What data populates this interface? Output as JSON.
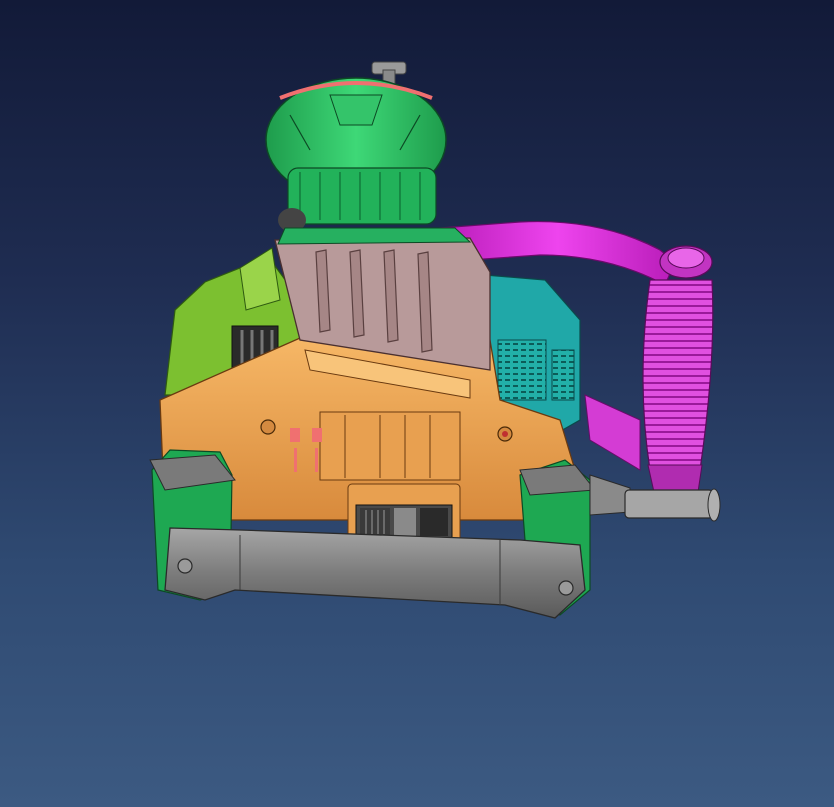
{
  "scene": {
    "background_top": "#121a38",
    "background_bottom": "#3c5a82"
  },
  "model": {
    "parts": [
      {
        "name": "chuck-collar",
        "color": "#2ccc66"
      },
      {
        "name": "chuck-ring",
        "color": "#f07070"
      },
      {
        "name": "side-handle-arm",
        "color": "#e020e0"
      },
      {
        "name": "side-handle-grip",
        "color": "#d040d0"
      },
      {
        "name": "motor-housing",
        "color": "#f0a858"
      },
      {
        "name": "left-housing-shell",
        "color": "#7cc030"
      },
      {
        "name": "right-vent-panel",
        "color": "#20a8a8"
      },
      {
        "name": "top-cover",
        "color": "#b89a9a"
      },
      {
        "name": "rear-handle",
        "color": "#8a8a8a"
      },
      {
        "name": "power-cable",
        "color": "#9a9a9a"
      },
      {
        "name": "switch-block",
        "color": "#5a5a5a"
      }
    ]
  }
}
